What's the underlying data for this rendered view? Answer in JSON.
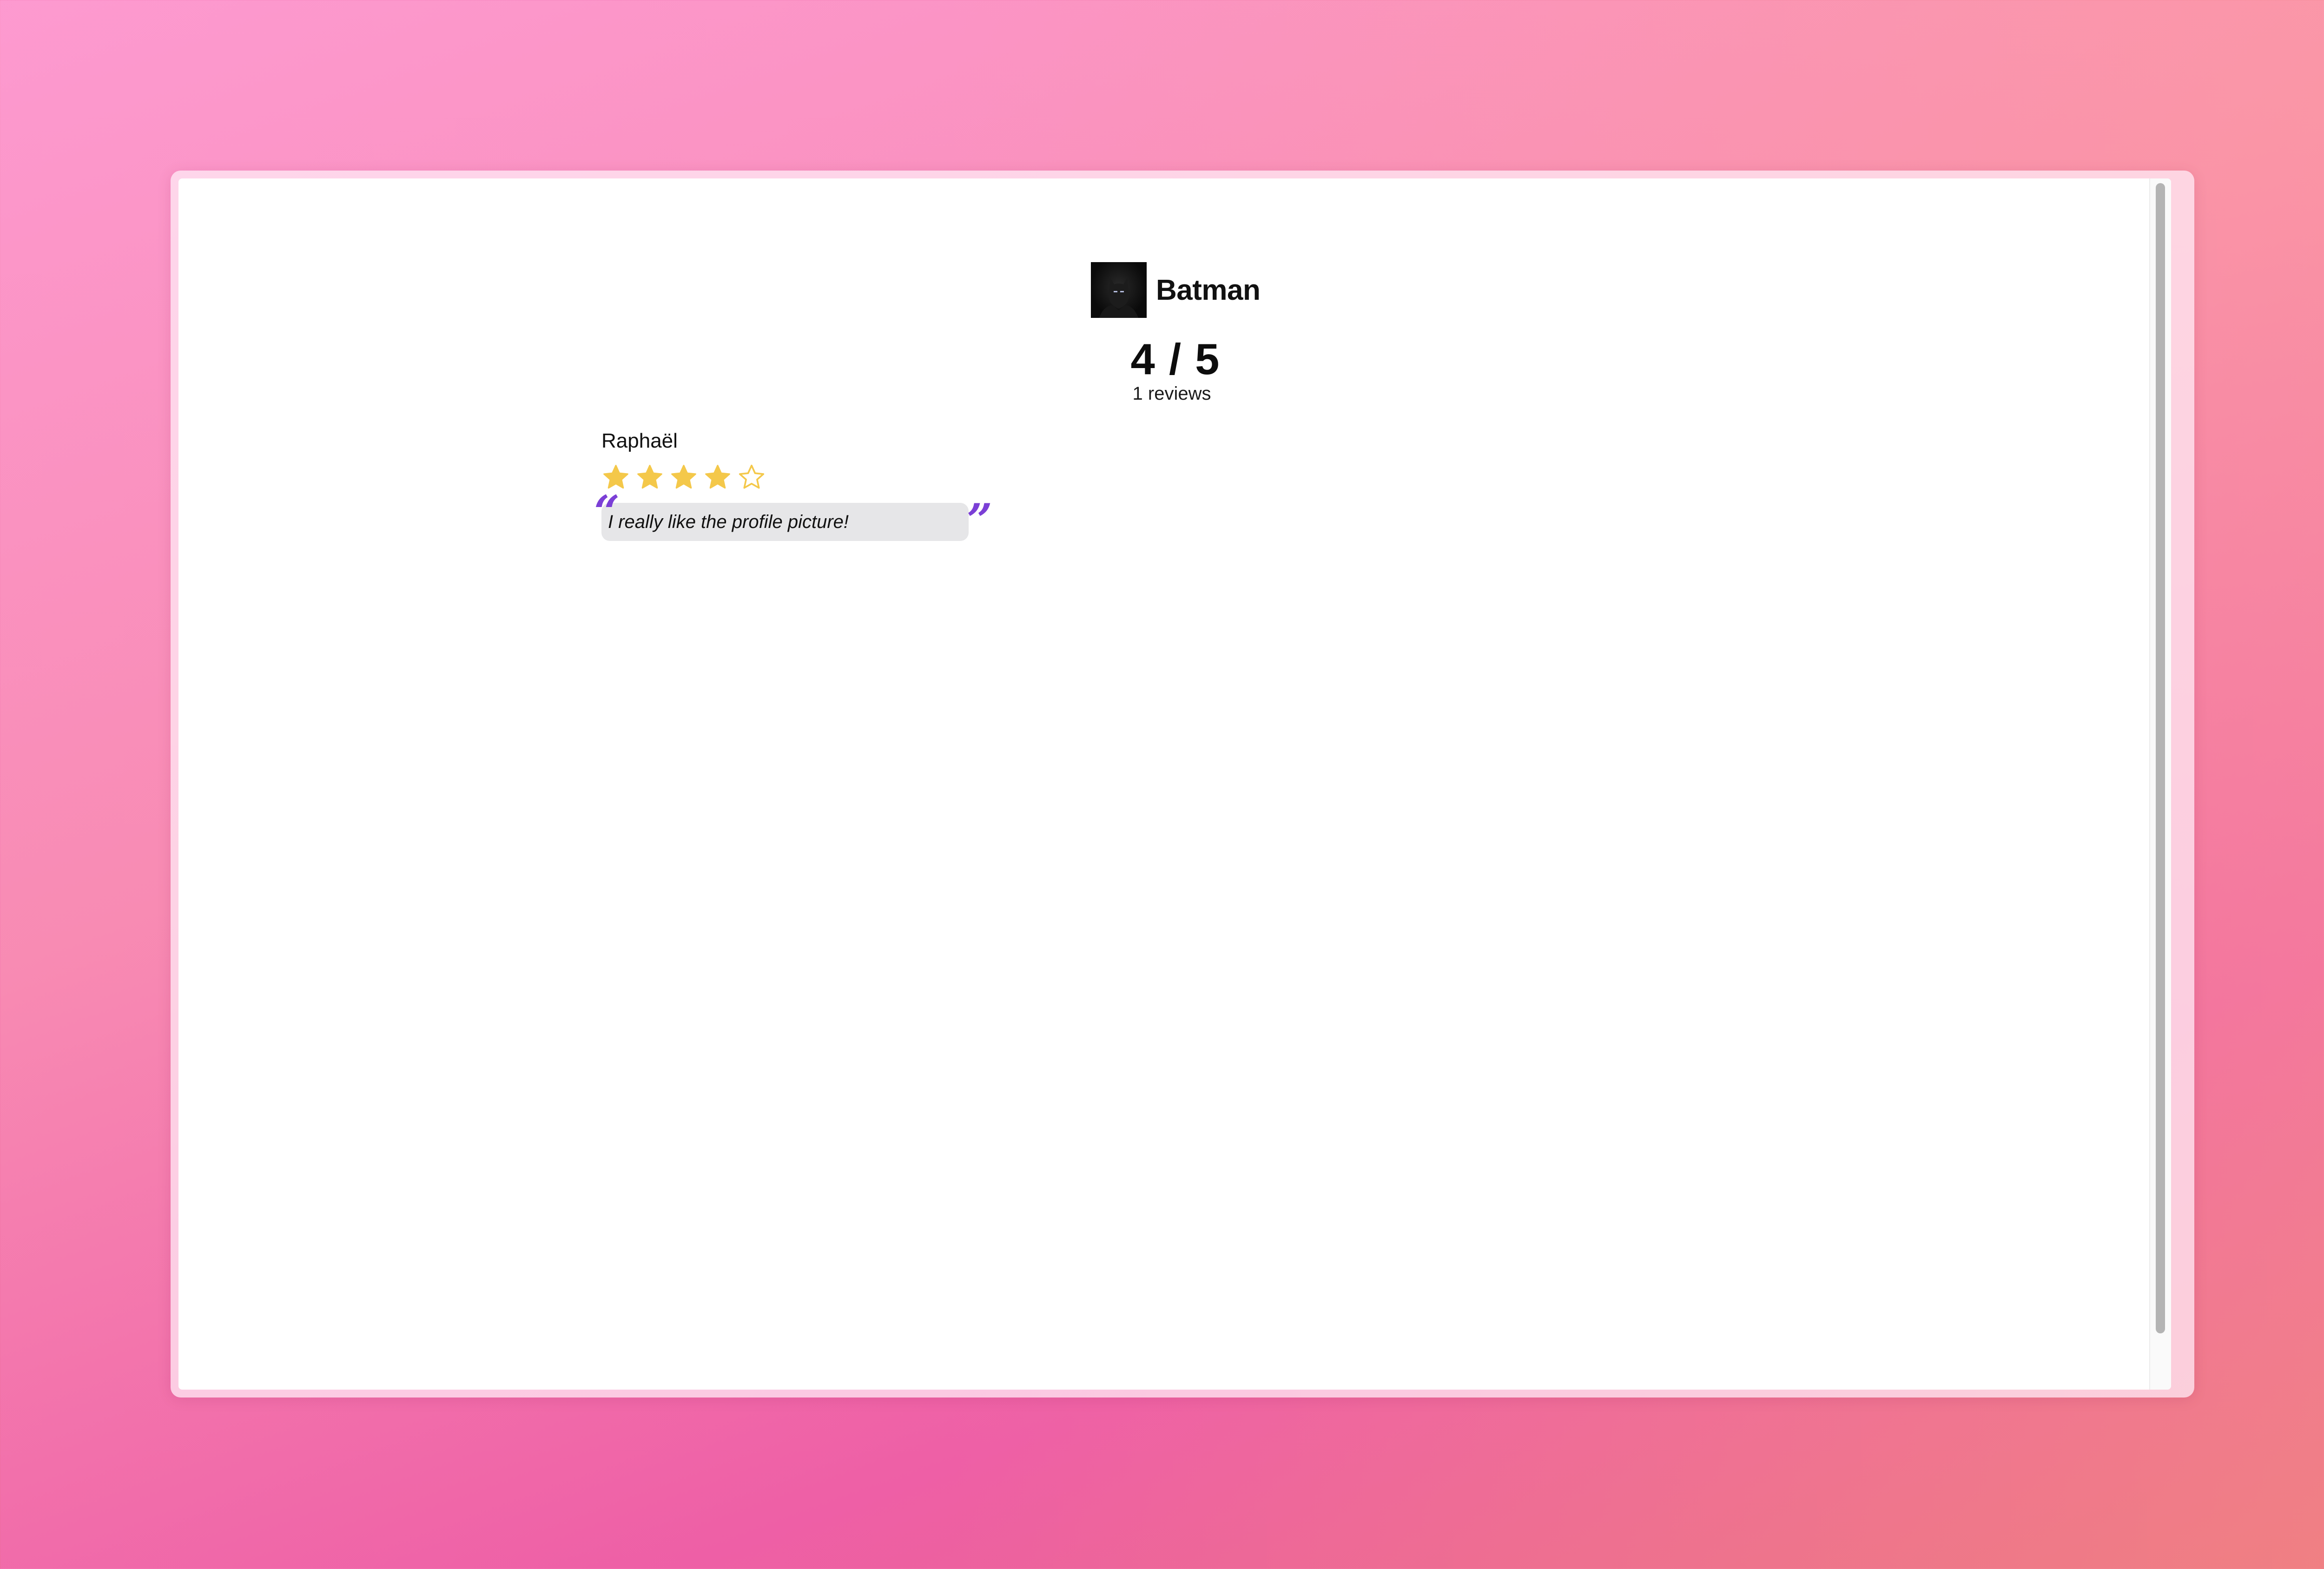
{
  "profile": {
    "name": "Batman"
  },
  "rating": {
    "score": "4 / 5",
    "reviews_label": "1 reviews"
  },
  "reviews": [
    {
      "author": "Raphaël",
      "stars": 4,
      "max_stars": 5,
      "text": "I really like the profile picture!"
    }
  ],
  "colors": {
    "star_fill": "#f4c84a",
    "quote_accent": "#7b3fd6",
    "quote_bg": "#e6e6e8"
  },
  "icons": {
    "quote_open": "“",
    "quote_close": "”"
  }
}
